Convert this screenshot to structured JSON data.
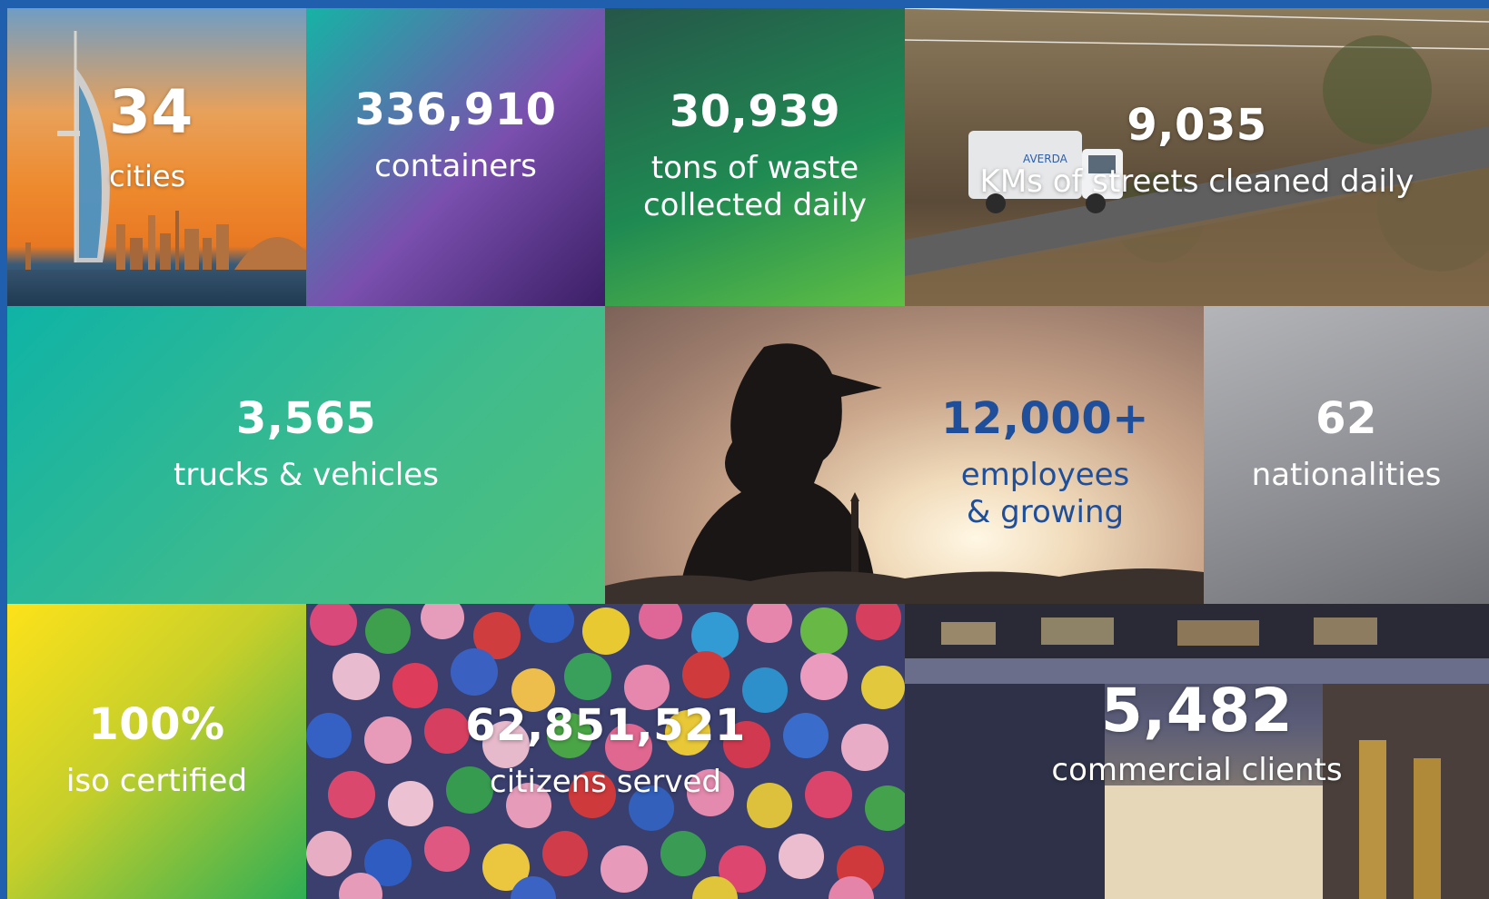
{
  "stats": [
    {
      "id": "cities",
      "number": "34",
      "label": "cities"
    },
    {
      "id": "containers",
      "number": "336,910",
      "label": "containers"
    },
    {
      "id": "waste",
      "number": "30,939",
      "label_line1": "tons of waste",
      "label_line2": "collected daily"
    },
    {
      "id": "streets",
      "number": "9,035",
      "label": "KMs of streets cleaned daily"
    },
    {
      "id": "trucks",
      "number": "3,565",
      "label": "trucks & vehicles"
    },
    {
      "id": "employees",
      "number": "12,000+",
      "label_line1": "employees",
      "label_line2": "& growing"
    },
    {
      "id": "nationalities",
      "number": "62",
      "label": "nationalities"
    },
    {
      "id": "iso",
      "number": "100%",
      "label": "iso certified"
    },
    {
      "id": "citizens",
      "number": "62,851,521",
      "label": "citizens served"
    },
    {
      "id": "clients",
      "number": "5,482",
      "label": "commercial clients"
    }
  ],
  "truck_logo": "AVERDA",
  "colors": {
    "frame": "#1f5fae",
    "employee_text": "#1f4f9a"
  }
}
